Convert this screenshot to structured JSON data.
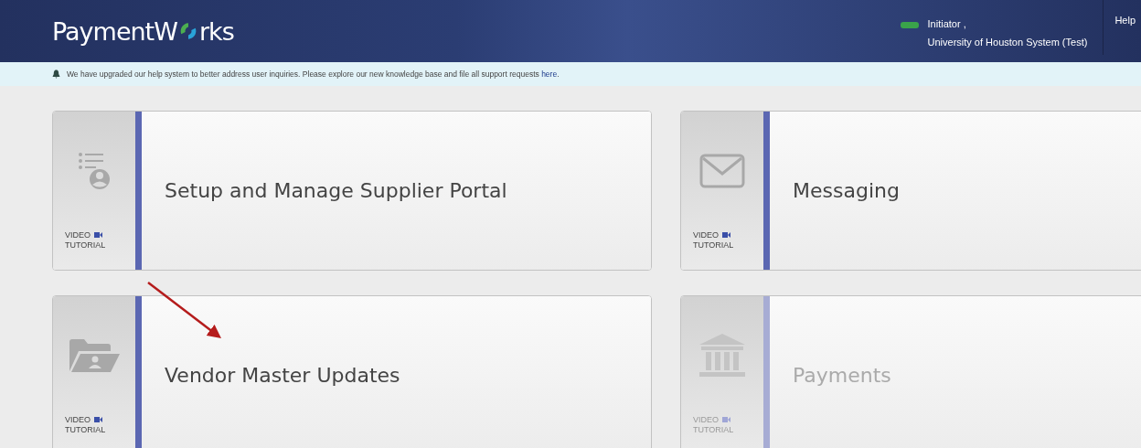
{
  "header": {
    "logo": {
      "before": "PaymentW",
      "after": "rks"
    },
    "user": {
      "role": "Initiator ,",
      "organization": "University of Houston System (Test)"
    },
    "help": "Help"
  },
  "notice": {
    "text": "We have upgraded our help system to better address user inquiries. Please explore our new knowledge base and file all support requests",
    "link": "here",
    "end": "."
  },
  "tiles": [
    {
      "title": "Setup and Manage Supplier Portal",
      "video": "VIDEO",
      "tutorial": "TUTORIAL",
      "disabled": false
    },
    {
      "title": "Messaging",
      "video": "VIDEO",
      "tutorial": "TUTORIAL",
      "disabled": false
    },
    {
      "title": "Vendor Master Updates",
      "video": "VIDEO",
      "tutorial": "TUTORIAL",
      "disabled": false
    },
    {
      "title": "Payments",
      "video": "VIDEO",
      "tutorial": "TUTORIAL",
      "disabled": true
    }
  ]
}
